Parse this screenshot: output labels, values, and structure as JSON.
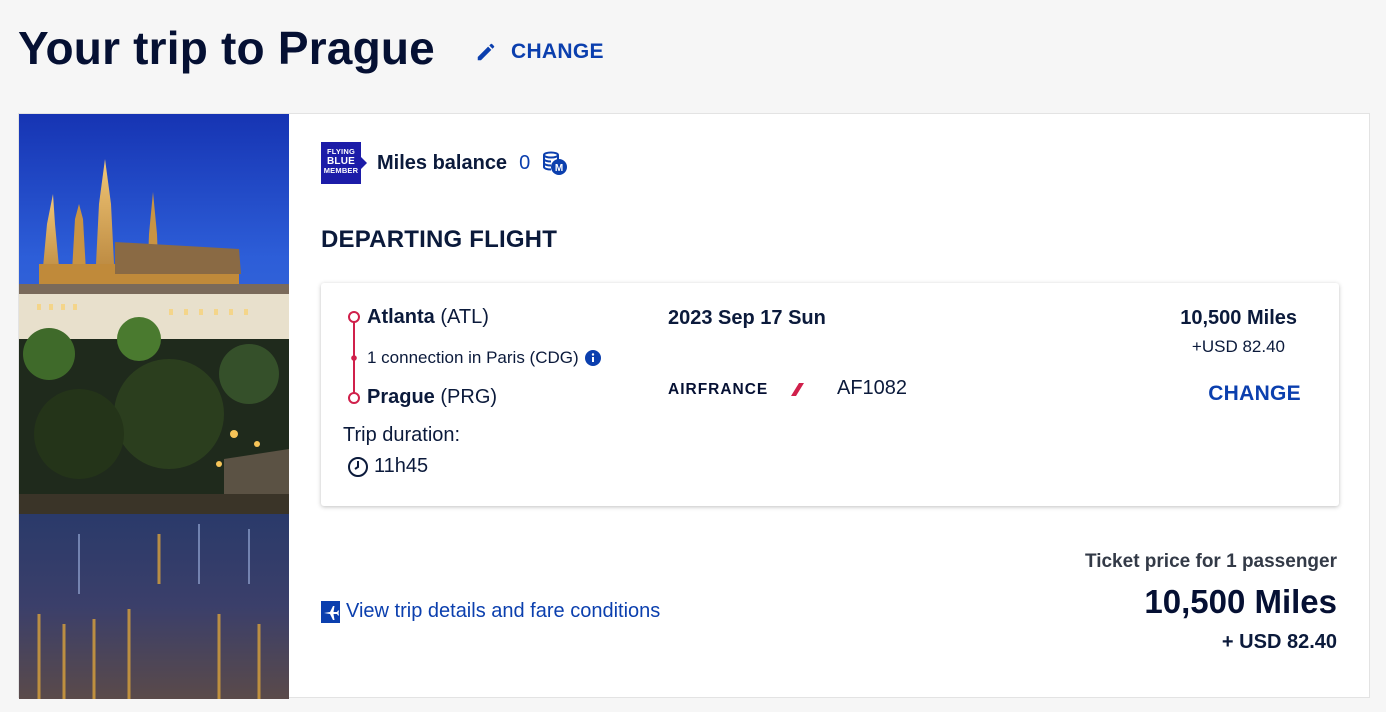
{
  "header": {
    "title": "Your trip to Prague",
    "change_label": "CHANGE"
  },
  "loyalty": {
    "logo_lines": [
      "FLYING",
      "BLUE",
      "MEMBER"
    ],
    "miles_label": "Miles balance",
    "miles_value": "0"
  },
  "section_title": "DEPARTING FLIGHT",
  "flight": {
    "origin_city": "Atlanta",
    "origin_code": "(ATL)",
    "connection": "1 connection in Paris (CDG)",
    "destination_city": "Prague",
    "destination_code": "(PRG)",
    "duration_label": "Trip duration:",
    "duration": "11h45",
    "date": "2023 Sep 17 Sun",
    "airline": "AIRFRANCE",
    "flight_number": "AF1082",
    "miles": "10,500 Miles",
    "usd": "+USD 82.40",
    "change_label": "CHANGE"
  },
  "details_link": "View trip details and fare conditions",
  "price": {
    "label": "Ticket price for 1 passenger",
    "miles": "10,500 Miles",
    "usd": "+ USD 82.40"
  },
  "colors": {
    "accent": "#0b3fae",
    "brand_blue": "#1c1ca8",
    "route_red": "#d0204b",
    "title": "#051033"
  },
  "icons": {
    "title_change": "pencil-icon",
    "miles": "coins-icon",
    "connection": "info-icon",
    "duration": "clock-icon",
    "details": "plane-icon"
  }
}
